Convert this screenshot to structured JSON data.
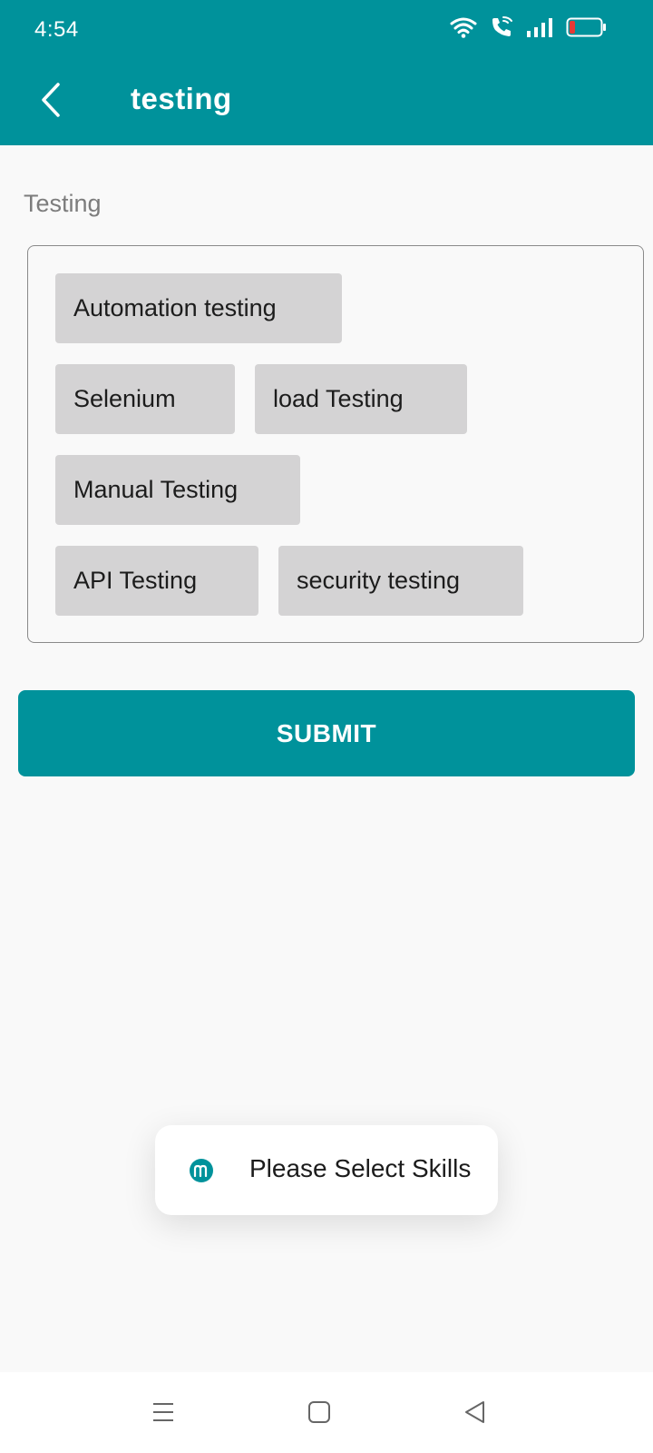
{
  "status_bar": {
    "time": "4:54",
    "icons": [
      "wifi-icon",
      "wifi-call-icon",
      "signal-icon",
      "battery-low-icon"
    ],
    "battery_color": "#e53935"
  },
  "app_bar": {
    "back_icon": "chevron-left-icon",
    "title": "testing",
    "background": "#00929b"
  },
  "section": {
    "label": "Testing"
  },
  "skills": [
    {
      "label": "Automation testing"
    },
    {
      "label": "Selenium"
    },
    {
      "label": "load Testing"
    },
    {
      "label": "Manual Testing"
    },
    {
      "label": "API Testing"
    },
    {
      "label": "security testing"
    }
  ],
  "submit": {
    "label": "SUBMIT"
  },
  "toast": {
    "logo_icon": "m-logo-icon",
    "message": "Please Select Skills"
  },
  "nav_bar": {
    "icons": [
      "menu-icon",
      "home-square-icon",
      "back-triangle-icon"
    ]
  }
}
